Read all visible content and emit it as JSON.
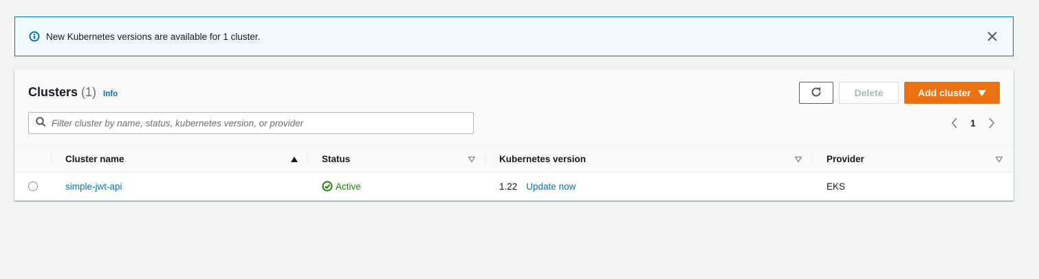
{
  "flash": {
    "message": "New Kubernetes versions are available for 1 cluster.",
    "info_icon": "info-circle-icon",
    "close_icon": "close-icon",
    "border_color": "#0073bb",
    "background_color": "#f1faff"
  },
  "header": {
    "title": "Clusters",
    "count": "(1)",
    "info_link": "Info",
    "refresh_icon": "refresh-icon",
    "delete_label": "Delete",
    "add_label": "Add cluster",
    "accent_color": "#ec7211"
  },
  "search": {
    "placeholder": "Filter cluster by name, status, kubernetes version, or provider",
    "value": ""
  },
  "pagination": {
    "current_page": "1"
  },
  "table": {
    "columns": [
      "Cluster name",
      "Status",
      "Kubernetes version",
      "Provider"
    ],
    "rows": [
      {
        "name": "simple-jwt-api",
        "status": "Active",
        "version": "1.22",
        "update_link": "Update now",
        "provider": "EKS"
      }
    ]
  }
}
